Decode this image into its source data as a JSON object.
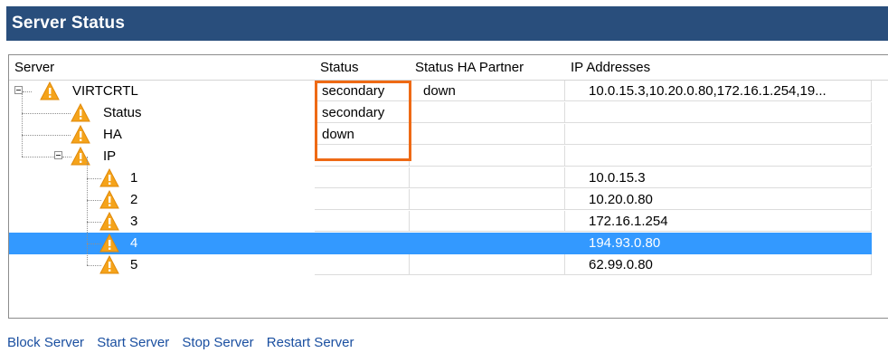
{
  "window": {
    "title": "Server Status"
  },
  "columns": {
    "server": "Server",
    "status": "Status",
    "partner": "Status HA Partner",
    "ip": "IP Addresses"
  },
  "rows": [
    {
      "server": "VIRTCRTL",
      "status": "secondary",
      "partner": "down",
      "ip": "10.0.15.3,10.20.0.80,172.16.1.254,19...",
      "level": 0,
      "expander": "minus"
    },
    {
      "server": "Status",
      "status": "secondary",
      "partner": "",
      "ip": "",
      "level": 1
    },
    {
      "server": "HA",
      "status": "down",
      "partner": "",
      "ip": "",
      "level": 1
    },
    {
      "server": "IP",
      "status": "",
      "partner": "",
      "ip": "",
      "level": 1,
      "expander": "minus"
    },
    {
      "server": "1",
      "status": "",
      "partner": "",
      "ip": "10.0.15.3",
      "level": 2
    },
    {
      "server": "2",
      "status": "",
      "partner": "",
      "ip": "10.20.0.80",
      "level": 2
    },
    {
      "server": "3",
      "status": "",
      "partner": "",
      "ip": "172.16.1.254",
      "level": 2
    },
    {
      "server": "4",
      "status": "",
      "partner": "",
      "ip": "194.93.0.80",
      "level": 2,
      "selected": true
    },
    {
      "server": "5",
      "status": "",
      "partner": "",
      "ip": "62.99.0.80",
      "level": 2
    }
  ],
  "actions": {
    "block": "Block Server",
    "start": "Start Server",
    "stop": "Stop Server",
    "restart": "Restart Server"
  },
  "icons": {
    "row_icon": "warning-icon"
  },
  "colors": {
    "title_bar": "#294e7c",
    "selection": "#3399ff",
    "highlight_box": "#ee6a15",
    "warning": "#f5a31a",
    "link": "#1a4fa0"
  }
}
